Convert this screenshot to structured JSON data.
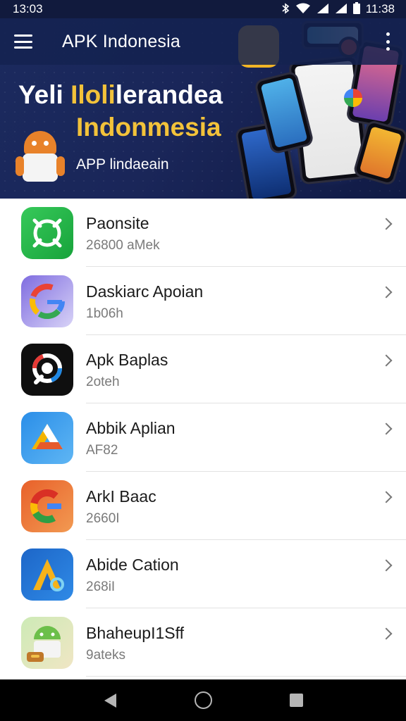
{
  "status_bar": {
    "left_time": "13:03",
    "right_time": "11:38",
    "icons": [
      "bluetooth-icon",
      "wifi-icon",
      "signal-icon",
      "signal-icon",
      "battery-icon"
    ]
  },
  "app_bar": {
    "title": "APK Indonesia"
  },
  "hero": {
    "title_white": "Yeli ",
    "title_accent": "Iloli",
    "title_rest": "lerandea",
    "title_line2": "Indonmesia",
    "subtitle": "APP lindaeain"
  },
  "apps": [
    {
      "title": "Paonsite",
      "subtitle": "26800 aMek",
      "icon": "chat-bubble-icon",
      "colors": [
        "#2fbe4f",
        "#18a23a"
      ]
    },
    {
      "title": "Daskiarc Apoian",
      "subtitle": "1b06h",
      "icon": "google-g-icon",
      "colors": [
        "#8e7de0",
        "#c9c2f5"
      ]
    },
    {
      "title": "Apk Baplas",
      "subtitle": "2oteh",
      "icon": "camera-lens-icon",
      "colors": [
        "#111111",
        "#222222"
      ]
    },
    {
      "title": "Abbik Aplian",
      "subtitle": "AF82",
      "icon": "drive-triangle-icon",
      "colors": [
        "#2a8ee8",
        "#63b7f5"
      ]
    },
    {
      "title": "ArkI Baac",
      "subtitle": "2660I",
      "icon": "google-g-icon",
      "colors": [
        "#ea6d2b",
        "#f39650"
      ]
    },
    {
      "title": "Abide Cation",
      "subtitle": "268iI",
      "icon": "a-letter-icon",
      "colors": [
        "#1f6fcf",
        "#2d87e4"
      ]
    },
    {
      "title": "BhaheupI1Sff",
      "subtitle": "9ateks",
      "icon": "android-robot-icon",
      "colors": [
        "#c9e8b0",
        "#f2c04a"
      ]
    }
  ],
  "colors": {
    "header_bg": "#1b2a5e",
    "accent_yellow": "#f2c23a",
    "status_bar_bg": "#111a3d"
  }
}
